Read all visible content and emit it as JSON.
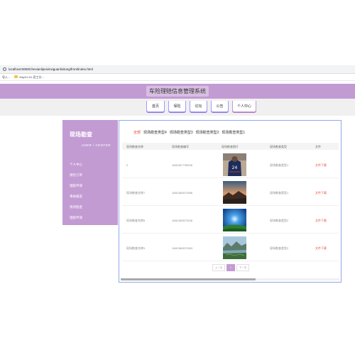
{
  "browser": {
    "url": "localhost:8080/chexianlipeixinxiguanlixitong/front/index.html",
    "bookmarks": [
      "导入...",
      "DayX1-01-员工分..."
    ]
  },
  "header": {
    "title": "车险理赔信息管理系统"
  },
  "nav": [
    "首页",
    "保险",
    "论坛",
    "公告",
    "个人中心"
  ],
  "sidebar": {
    "title": "现场勘查",
    "subtitle": "USER / CENTER",
    "items": [
      "个人中心",
      "保险订单",
      "理赔申请",
      "事故报案",
      "现场勘查",
      "理赔申请"
    ]
  },
  "tabs": [
    "全部",
    "现场勘查类型4",
    "现场勘查类型3",
    "现场勘查类型2",
    "现场勘查类型1"
  ],
  "table": {
    "headers": [
      "现场勘查名称",
      "现场勘查编号",
      "现场勘查照片",
      "现场勘查类型",
      "文件"
    ],
    "rows": [
      {
        "name": "2",
        "code": "1681367739646",
        "type": "现场勘查类型1",
        "file": "文件下载"
      },
      {
        "name": "现场勘查名称7",
        "code": "1681366573386",
        "type": "现场勘查类型1",
        "file": "文件下载"
      },
      {
        "name": "现场勘查名称8",
        "code": "1681366573338",
        "type": "现场勘查类型2",
        "file": "文件下载"
      },
      {
        "name": "现场勘查名称9",
        "code": "1681366573383",
        "type": "现场勘查类型2",
        "file": "文件下载"
      }
    ]
  },
  "pagination": {
    "prev": "上一页",
    "current": "1",
    "next": "下一页"
  }
}
